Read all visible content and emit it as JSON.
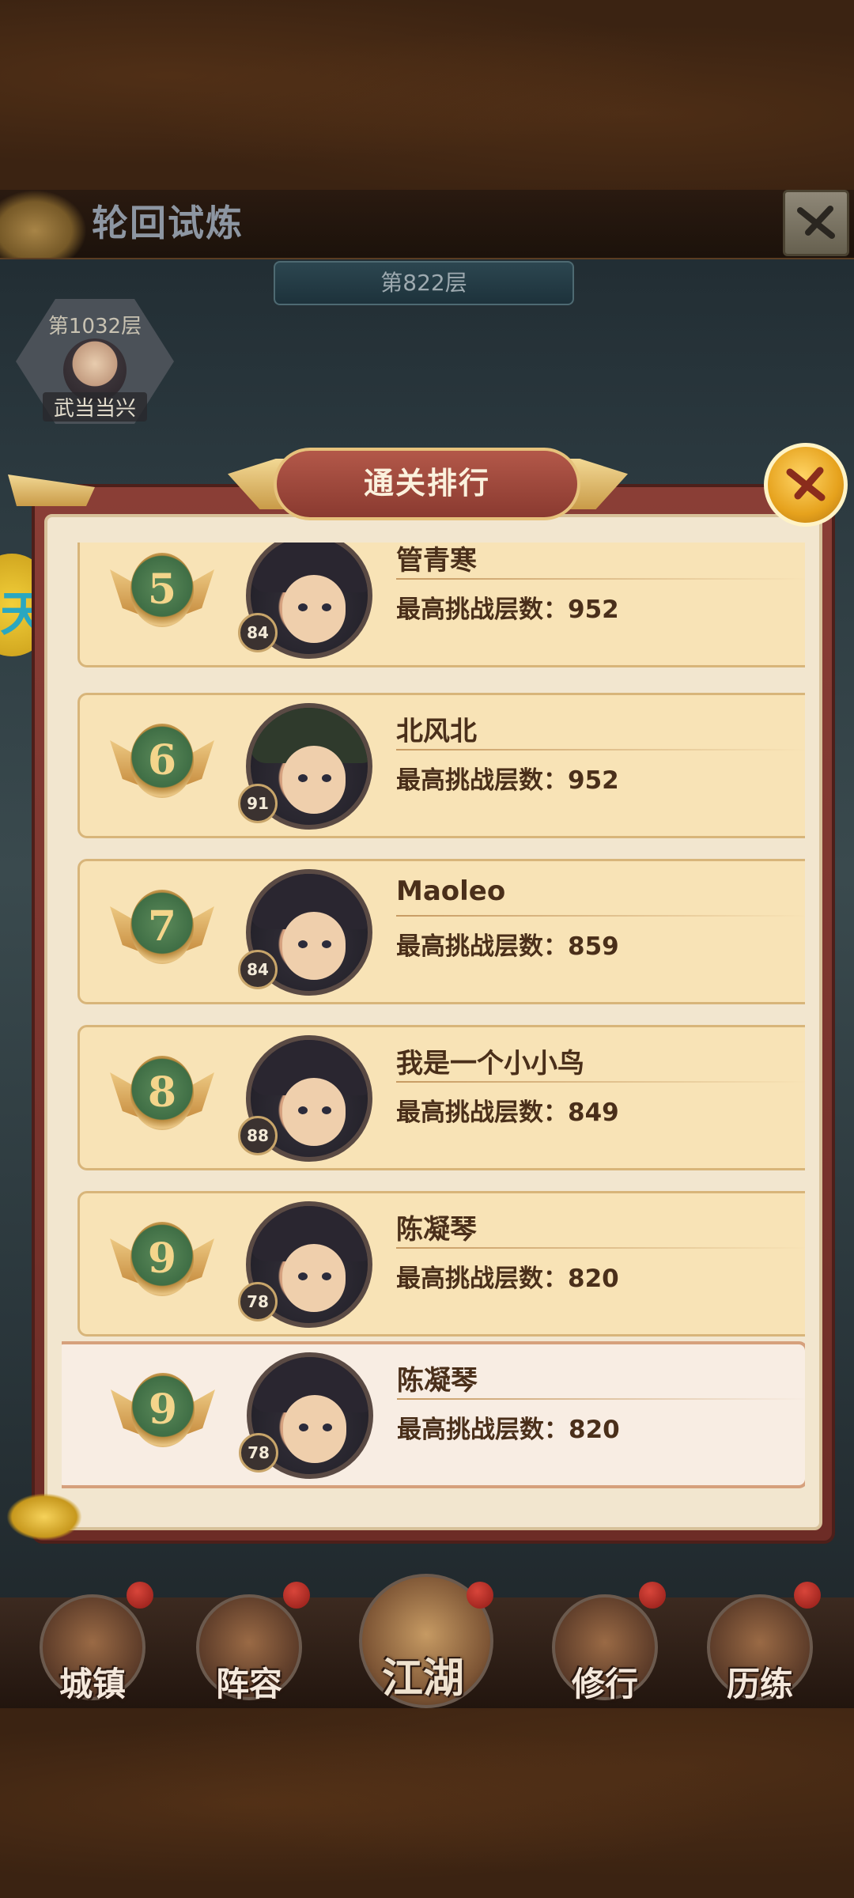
{
  "top_bar": {
    "title": "轮回试炼"
  },
  "floor_banner": {
    "text": "第822层"
  },
  "player_badge": {
    "floor": "第1032层",
    "name": "武当当兴"
  },
  "modal": {
    "title": "通关排行",
    "rows": [
      {
        "rank": "5",
        "level": "84",
        "name": "管青寒",
        "score": "最高挑战层数：952"
      },
      {
        "rank": "6",
        "level": "91",
        "name": "北风北",
        "score": "最高挑战层数：952"
      },
      {
        "rank": "7",
        "level": "84",
        "name": "Maoleo",
        "score": "最高挑战层数：859"
      },
      {
        "rank": "8",
        "level": "88",
        "name": "我是一个小小鸟",
        "score": "最高挑战层数：849"
      },
      {
        "rank": "9",
        "level": "78",
        "name": "陈凝琴",
        "score": "最高挑战层数：820"
      }
    ],
    "my_row": {
      "rank": "9",
      "level": "78",
      "name": "陈凝琴",
      "score": "最高挑战层数：820"
    }
  },
  "bottom_nav": [
    {
      "label": "城镇"
    },
    {
      "label": "阵容"
    },
    {
      "label": "江湖"
    },
    {
      "label": "修行"
    },
    {
      "label": "历练"
    }
  ],
  "icons": {
    "close": "crossed-x-icon",
    "modal_close": "crossed-x-icon"
  },
  "colors": {
    "panel_red": "#8a3e36",
    "row_bg": "#f8e3b6",
    "text_brown": "#4a2f1a",
    "gold": "#e6a21d"
  }
}
